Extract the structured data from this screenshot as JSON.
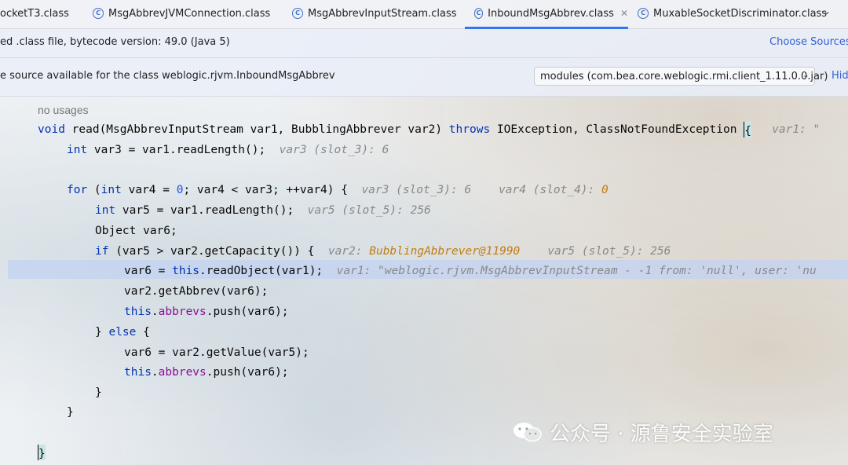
{
  "tabs": [
    {
      "label": "ocketT3.class"
    },
    {
      "label": "MsgAbbrevJVMConnection.class"
    },
    {
      "label": "MsgAbbrevInputStream.class"
    },
    {
      "label": "InboundMsgAbbrev.class",
      "active": true
    },
    {
      "label": "MuxableSocketDiscriminator.class"
    }
  ],
  "banner_decompiled": {
    "message": "ed .class file, bytecode version: 49.0 (Java 5)",
    "link": "Choose Sources..."
  },
  "banner_source": {
    "message": "e source available for the class weblogic.rjvm.InboundMsgAbbrev",
    "module_select": "modules (com.bea.core.weblogic.rmi.client_1.11.0.0.jar)",
    "hide_link": "Hide"
  },
  "code": {
    "usages": "no usages",
    "l1": {
      "kw_void": "void",
      "t1": " read(MsgAbbrevInputStream var1, BubblingAbbrever var2) ",
      "kw_throws": "throws",
      "t2": " IOException, ClassNotFoundException ",
      "brace": "{",
      "hint": "var1: \""
    },
    "l2": {
      "kw_int": "int",
      "t": " var3 = var1.readLength();",
      "hint": "var3 (slot_3): 6"
    },
    "l3": {
      "kw_for": "for",
      "t1": " (",
      "kw_int": "int",
      "t2": " var4 = ",
      "zero": "0",
      "t3": "; var4 < var3; ++var4) {",
      "hint_a": "var3 (slot_3): 6",
      "hint_b_name": "var4 (slot_4): ",
      "hint_b_val": "0"
    },
    "l4": {
      "kw_int": "int",
      "t": " var5 = var1.readLength();",
      "hint": "var5 (slot_5): 256"
    },
    "l5": {
      "t": "Object var6;"
    },
    "l6": {
      "kw_if": "if",
      "t": " (var5 > var2.getCapacity()) {",
      "hint_a_name": "var2: ",
      "hint_a_val": "BubblingAbbrever@11990",
      "hint_b": "var5 (slot_5): 256"
    },
    "l7": {
      "t1": "var6 = ",
      "kw_this": "this",
      "t2": ".readObject(var1);",
      "hint": "var1: \"weblogic.rjvm.MsgAbbrevInputStream - -1 from: 'null', user: 'nu"
    },
    "l8": {
      "t": "var2.getAbbrev(var6);"
    },
    "l9": {
      "kw_this": "this",
      "dot": ".",
      "field": "abbrevs",
      "t": ".push(var6);"
    },
    "l10": {
      "t1": "} ",
      "kw_else": "else",
      "t2": " {"
    },
    "l11": {
      "t": "var6 = var2.getValue(var5);"
    },
    "l12": {
      "kw_this": "this",
      "dot": ".",
      "field": "abbrevs",
      "t": ".push(var6);"
    },
    "l13": {
      "t": "}"
    },
    "l14": {
      "t": "}"
    },
    "l15": {
      "t": "}"
    }
  },
  "watermark": {
    "text": "公众号 · 源鲁安全实验室"
  }
}
